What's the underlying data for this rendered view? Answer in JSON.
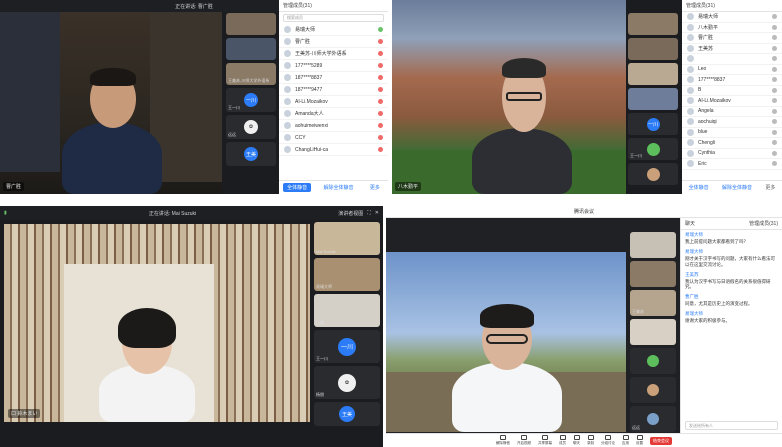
{
  "q1": {
    "topbar_title": "正在讲话: 曹广胜",
    "main_name": "曹广胜",
    "thumbs": [
      "",
      "",
      "王美苏-川师大学外语系"
    ],
    "avatar_label": "一川",
    "avatar_caption": "王一川",
    "avatar2_caption": "远远",
    "avatar3_label": "王美",
    "panel_title": "管理成员(31)",
    "search_placeholder": "搜索成员",
    "participants": [
      {
        "name": "易瑞大师",
        "ok": true
      },
      {
        "name": "曹广胜",
        "ok": false
      },
      {
        "name": "王美苏-川师大学外语系",
        "ok": false
      },
      {
        "name": "177****5289",
        "ok": false
      },
      {
        "name": "187****8837",
        "ok": false
      },
      {
        "name": "187****9477",
        "ok": false
      },
      {
        "name": "AI-Li.Mozaikov",
        "ok": false
      },
      {
        "name": "Amanda大人",
        "ok": false
      },
      {
        "name": "aohuimeiwenxi",
        "ok": false
      },
      {
        "name": "CCY",
        "ok": false
      },
      {
        "name": "ChangLiHui-ca",
        "ok": false
      }
    ],
    "foot_mute": "全体静音",
    "foot_unmute": "解除全体静音",
    "foot_more": "更多"
  },
  "q2": {
    "main_name": "八木勤平",
    "panel_title": "管理成员(31)",
    "participants": [
      "易瑞大师",
      "八木勤平",
      "曹广胜",
      "王美苏",
      "",
      "Leo",
      "177****8837",
      "B",
      "AI-Li.Mozaikov",
      "Angela",
      "aochuiqi",
      "blue",
      "Chengli",
      "Cynthia",
      "Eric"
    ],
    "avatar_label": "一川",
    "avatar_caption": "王一川",
    "foot_mute": "全体静音",
    "foot_unmute": "解除全体静音",
    "foot_more": "更多"
  },
  "q3": {
    "topbar_title": "正在讲话: Mai Suzuki",
    "view_label": "演讲者视图",
    "main_caption": "口 鈴木まい",
    "thumbs": [
      "Mai Suzuki",
      "易瑞大师",
      "日暮"
    ],
    "avatar_label": "一川",
    "avatar_caption": "王一川",
    "avatar2_caption": "杨朋",
    "avatar3_caption": "王美"
  },
  "q4": {
    "topbar_title": "腾讯会议",
    "panel_title": "聊天",
    "member_title": "管理成员(31)",
    "chat": [
      {
        "who": "易瑞大师",
        "txt": "我上前提问题大家都看到了吗？"
      },
      {
        "who": "易瑞大师",
        "txt": "刚才关于汉字书写的问题，大家有什么看法可以在这里交流讨论。"
      },
      {
        "who": "王美苏",
        "txt": "我认为汉字书写与日语假名的关系很值得研究。"
      },
      {
        "who": "曹广胜",
        "txt": "同意，尤其是历史上的演变过程。"
      },
      {
        "who": "易瑞大师",
        "txt": "谢谢大家的积极参与。"
      }
    ],
    "thumb_labels": [
      "",
      "",
      "王美苏",
      "",
      "",
      "",
      "远远"
    ],
    "input_placeholder": "发送给所有人",
    "tools": [
      "解除静音",
      "开启视频",
      "共享屏幕",
      "成员",
      "聊天",
      "录制",
      "分组讨论",
      "应用",
      "设置"
    ],
    "leave_label": "结束会议"
  }
}
